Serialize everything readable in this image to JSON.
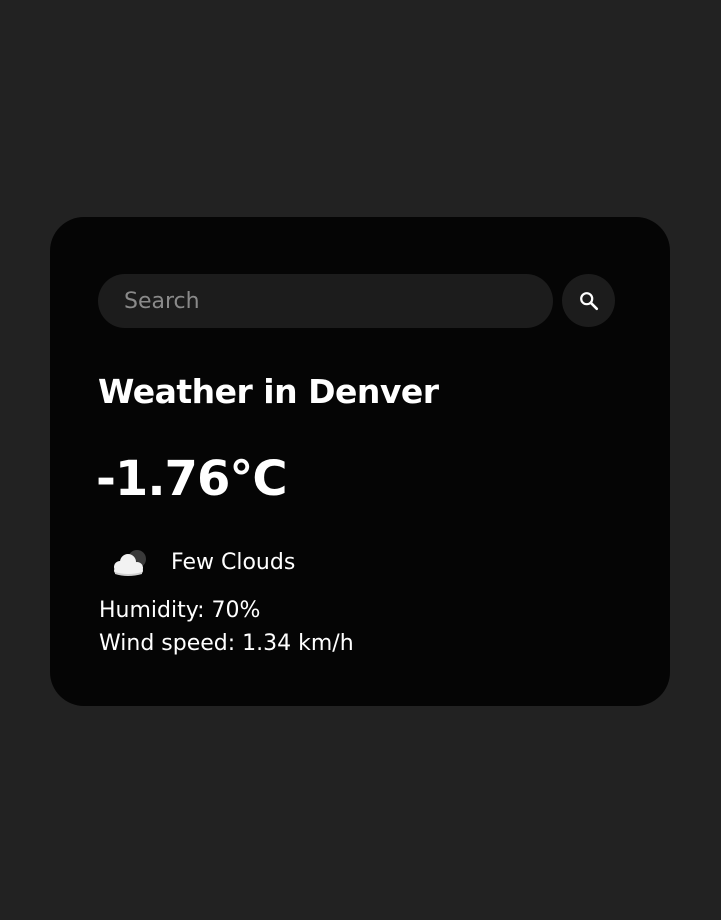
{
  "search": {
    "placeholder": "Search",
    "value": "",
    "button_icon": "search-icon"
  },
  "weather": {
    "title": "Weather in Denver",
    "temperature": "-1.76°C",
    "icon": "few-clouds-icon",
    "description": "Few Clouds",
    "humidity": "Humidity: 70%",
    "wind": "Wind speed: 1.34 km/h"
  },
  "colors": {
    "page_background": "#222222",
    "card_background": "#050505",
    "input_background": "#1c1c1c",
    "text": "#ffffff",
    "placeholder": "#8a8a8a"
  }
}
